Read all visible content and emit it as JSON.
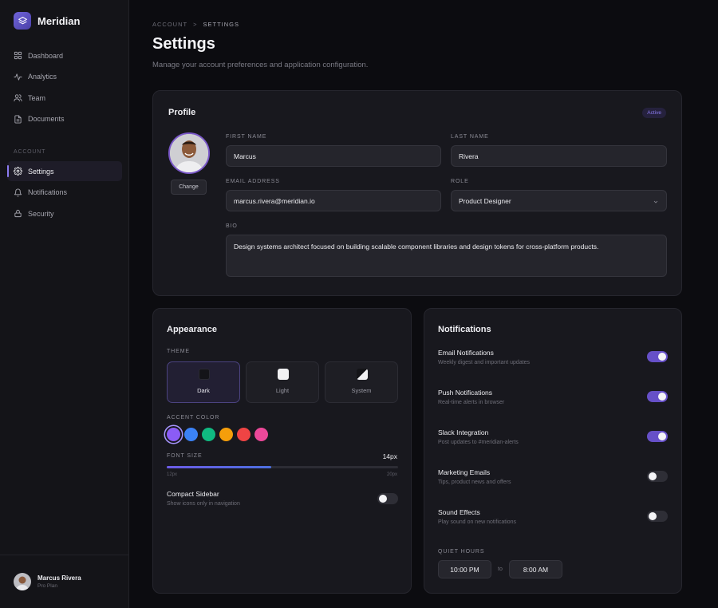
{
  "brand": {
    "name": "Meridian"
  },
  "sidebar": {
    "items": [
      {
        "label": "Dashboard",
        "icon": "grid-icon"
      },
      {
        "label": "Analytics",
        "icon": "activity-icon"
      },
      {
        "label": "Team",
        "icon": "users-icon"
      },
      {
        "label": "Documents",
        "icon": "file-icon"
      }
    ],
    "section_label": "ACCOUNT",
    "account_items": [
      {
        "label": "Settings",
        "icon": "gear-icon",
        "active": true
      },
      {
        "label": "Notifications",
        "icon": "bell-icon"
      },
      {
        "label": "Security",
        "icon": "lock-icon"
      }
    ],
    "user": {
      "name": "Marcus Rivera",
      "plan": "Pro Plan"
    }
  },
  "breadcrumb": {
    "parent": "ACCOUNT",
    "separator": ">",
    "current": "SETTINGS"
  },
  "page": {
    "title": "Settings",
    "subtitle": "Manage your account preferences and application configuration."
  },
  "profile": {
    "title": "Profile",
    "status": "Active",
    "change_label": "Change",
    "first_name_label": "FIRST NAME",
    "first_name": "Marcus",
    "last_name_label": "LAST NAME",
    "last_name": "Rivera",
    "email_label": "EMAIL ADDRESS",
    "email": "marcus.rivera@meridian.io",
    "role_label": "ROLE",
    "role": "Product Designer",
    "bio_label": "BIO",
    "bio": "Design systems architect focused on building scalable component libraries and design tokens for cross-platform products."
  },
  "appearance": {
    "title": "Appearance",
    "theme_label": "THEME",
    "themes": [
      {
        "label": "Dark",
        "selected": true
      },
      {
        "label": "Light",
        "selected": false
      },
      {
        "label": "System",
        "selected": false
      }
    ],
    "accent_label": "ACCENT COLOR",
    "accents": [
      "#8b5cf6",
      "#3b82f6",
      "#10b981",
      "#f59e0b",
      "#ef4444",
      "#ec4899"
    ],
    "font_size_label": "FONT SIZE",
    "font_size_value": "14px",
    "font_size_min": "12px",
    "font_size_max": "20px",
    "font_size_fraction": 0.45,
    "compact_title": "Compact Sidebar",
    "compact_desc": "Show icons only in navigation",
    "compact_on": false
  },
  "notifications": {
    "title": "Notifications",
    "items": [
      {
        "title": "Email Notifications",
        "desc": "Weekly digest and important updates",
        "on": true
      },
      {
        "title": "Push Notifications",
        "desc": "Real-time alerts in browser",
        "on": true
      },
      {
        "title": "Slack Integration",
        "desc": "Post updates to #meridian-alerts",
        "on": true
      },
      {
        "title": "Marketing Emails",
        "desc": "Tips, product news and offers",
        "on": false
      },
      {
        "title": "Sound Effects",
        "desc": "Play sound on new notifications",
        "on": false
      }
    ],
    "quiet_label": "QUIET HOURS",
    "quiet_from": "10:00 PM",
    "quiet_to_sep": "to",
    "quiet_to": "8:00 AM"
  }
}
